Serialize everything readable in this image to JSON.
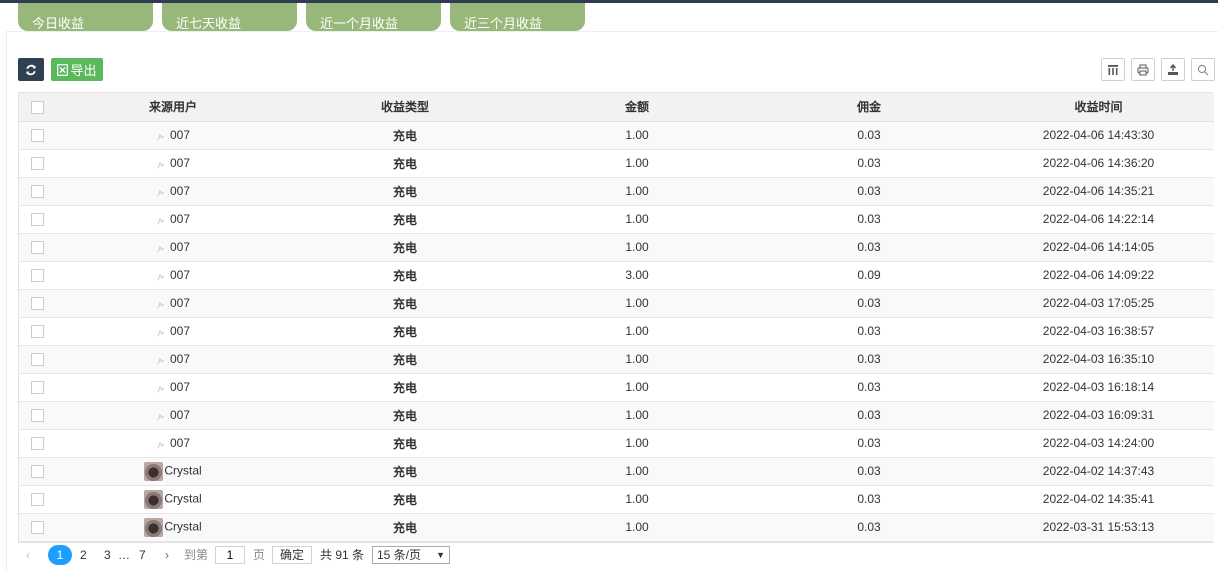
{
  "tabs": [
    "今日收益",
    "近七天收益",
    "近一个月收益",
    "近三个月收益"
  ],
  "toolbar": {
    "export_label": "导出"
  },
  "table": {
    "headers": [
      "来源用户",
      "收益类型",
      "金额",
      "佣金",
      "收益时间"
    ],
    "rows": [
      {
        "user": "007",
        "avatar": "broken",
        "type": "充电",
        "amount": "1.00",
        "commission": "0.03",
        "time": "2022-04-06 14:43:30"
      },
      {
        "user": "007",
        "avatar": "broken",
        "type": "充电",
        "amount": "1.00",
        "commission": "0.03",
        "time": "2022-04-06 14:36:20"
      },
      {
        "user": "007",
        "avatar": "broken",
        "type": "充电",
        "amount": "1.00",
        "commission": "0.03",
        "time": "2022-04-06 14:35:21"
      },
      {
        "user": "007",
        "avatar": "broken",
        "type": "充电",
        "amount": "1.00",
        "commission": "0.03",
        "time": "2022-04-06 14:22:14"
      },
      {
        "user": "007",
        "avatar": "broken",
        "type": "充电",
        "amount": "1.00",
        "commission": "0.03",
        "time": "2022-04-06 14:14:05"
      },
      {
        "user": "007",
        "avatar": "broken",
        "type": "充电",
        "amount": "3.00",
        "commission": "0.09",
        "time": "2022-04-06 14:09:22"
      },
      {
        "user": "007",
        "avatar": "broken",
        "type": "充电",
        "amount": "1.00",
        "commission": "0.03",
        "time": "2022-04-03 17:05:25"
      },
      {
        "user": "007",
        "avatar": "broken",
        "type": "充电",
        "amount": "1.00",
        "commission": "0.03",
        "time": "2022-04-03 16:38:57"
      },
      {
        "user": "007",
        "avatar": "broken",
        "type": "充电",
        "amount": "1.00",
        "commission": "0.03",
        "time": "2022-04-03 16:35:10"
      },
      {
        "user": "007",
        "avatar": "broken",
        "type": "充电",
        "amount": "1.00",
        "commission": "0.03",
        "time": "2022-04-03 16:18:14"
      },
      {
        "user": "007",
        "avatar": "broken",
        "type": "充电",
        "amount": "1.00",
        "commission": "0.03",
        "time": "2022-04-03 16:09:31"
      },
      {
        "user": "007",
        "avatar": "broken",
        "type": "充电",
        "amount": "1.00",
        "commission": "0.03",
        "time": "2022-04-03 14:24:00"
      },
      {
        "user": "Crystal",
        "avatar": "photo",
        "type": "充电",
        "amount": "1.00",
        "commission": "0.03",
        "time": "2022-04-02 14:37:43"
      },
      {
        "user": "Crystal",
        "avatar": "photo",
        "type": "充电",
        "amount": "1.00",
        "commission": "0.03",
        "time": "2022-04-02 14:35:41"
      },
      {
        "user": "Crystal",
        "avatar": "photo",
        "type": "充电",
        "amount": "1.00",
        "commission": "0.03",
        "time": "2022-03-31 15:53:13"
      }
    ]
  },
  "pagination": {
    "prev": "‹",
    "current": "1",
    "page2": "2",
    "page3": "3",
    "ellipsis": "…",
    "last": "7",
    "next": "›",
    "goto_label": "到第",
    "goto_value": "1",
    "page_unit": "页",
    "confirm": "确定",
    "total": "共 91 条",
    "page_size": "15 条/页"
  },
  "colors": {
    "tab_bg": "#97b87a",
    "refresh_bg": "#2f4050",
    "export_bg": "#5cb85c",
    "pager_active": "#1e9fff"
  }
}
